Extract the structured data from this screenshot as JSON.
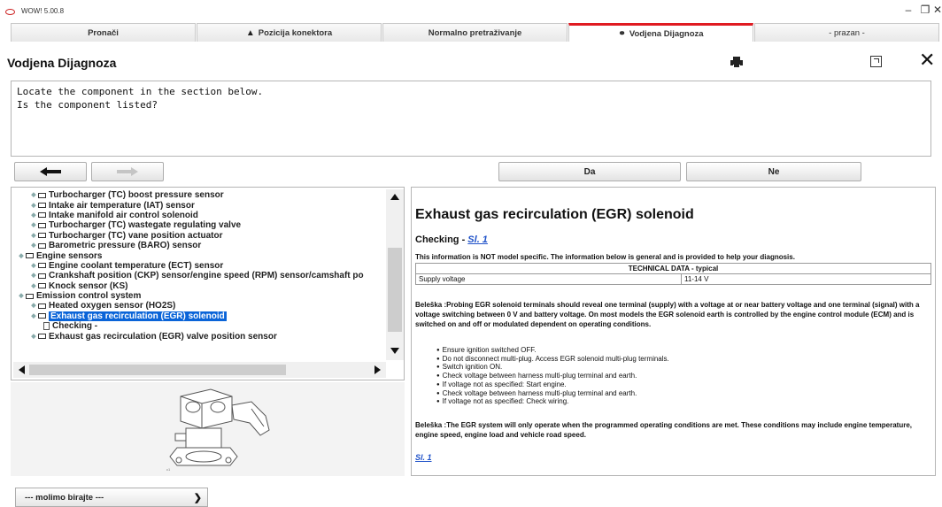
{
  "window": {
    "title": "WOW! 5.00.8",
    "controls": [
      "–",
      "❐",
      "✕"
    ]
  },
  "tabs": [
    {
      "label": "Pronači",
      "icon": "",
      "active": false
    },
    {
      "label": "Pozicija konektora",
      "icon": "connector-icon",
      "active": false
    },
    {
      "label": "Normalno pretraživanje",
      "icon": "",
      "active": false
    },
    {
      "label": "Vodjena Dijagnoza",
      "icon": "stethoscope-icon",
      "active": true
    },
    {
      "label": "- prazan -",
      "icon": "",
      "active": false
    }
  ],
  "header": {
    "title": "Vodjena Dijagnoza",
    "close": "✕"
  },
  "question": {
    "text": "Locate the component in the section below.\nIs the component listed?"
  },
  "nav": {
    "yes": "Da",
    "no": "Ne"
  },
  "tree": {
    "items": [
      {
        "level": 2,
        "label": "Turbocharger (TC) boost pressure sensor",
        "type": "folder",
        "selected": false
      },
      {
        "level": 2,
        "label": "Intake air temperature (IAT) sensor",
        "type": "folder",
        "selected": false
      },
      {
        "level": 2,
        "label": "Intake manifold air control solenoid",
        "type": "folder",
        "selected": false
      },
      {
        "level": 2,
        "label": "Turbocharger (TC) wastegate regulating valve",
        "type": "folder",
        "selected": false
      },
      {
        "level": 2,
        "label": "Turbocharger (TC) vane position actuator",
        "type": "folder",
        "selected": false
      },
      {
        "level": 2,
        "label": "Barometric pressure (BARO) sensor",
        "type": "folder",
        "selected": false
      },
      {
        "level": 1,
        "label": "Engine sensors",
        "type": "folder",
        "selected": false
      },
      {
        "level": 2,
        "label": "Engine coolant temperature (ECT) sensor",
        "type": "folder",
        "selected": false
      },
      {
        "level": 2,
        "label": "Crankshaft position (CKP) sensor/engine speed (RPM) sensor/camshaft po",
        "type": "folder",
        "selected": false
      },
      {
        "level": 2,
        "label": "Knock sensor (KS)",
        "type": "folder",
        "selected": false
      },
      {
        "level": 1,
        "label": "Emission control system",
        "type": "folder",
        "selected": false
      },
      {
        "level": 2,
        "label": "Heated oxygen sensor (HO2S)",
        "type": "folder",
        "selected": false
      },
      {
        "level": 2,
        "label": "Exhaust gas recirculation (EGR) solenoid",
        "type": "folder",
        "selected": true
      },
      {
        "level": 3,
        "label": "Checking -",
        "type": "doc",
        "selected": false
      },
      {
        "level": 2,
        "label": "Exhaust gas recirculation (EGR) valve position sensor",
        "type": "folder",
        "selected": false
      }
    ]
  },
  "info": {
    "title": "Exhaust gas recirculation (EGR) solenoid",
    "checking_label": "Checking - ",
    "checking_link": "Sl. 1",
    "note": "This information is NOT model specific. The information below is general and is provided to help your diagnosis.",
    "tech_header": "TECHNICAL DATA - typical",
    "tech_rows": [
      {
        "name": "Supply voltage",
        "value": "11-14 V"
      }
    ],
    "paragraph1": "Beleška :Probing EGR solenoid terminals should reveal one terminal (supply) with a voltage at or near battery voltage and one terminal (signal) with a voltage switching between 0 V and battery voltage. On most models the EGR solenoid earth is controlled by the engine control module (ECM) and is switched on and off or modulated dependent on operating conditions.",
    "steps": [
      "Ensure ignition switched OFF.",
      "Do not disconnect multi-plug. Access EGR solenoid multi-plug terminals.",
      "Switch ignition ON.",
      "Check voltage between harness multi-plug terminal and earth.",
      "If voltage not as specified: Start engine.",
      "Check voltage between harness multi-plug terminal and earth.",
      "If voltage not as specified: Check wiring."
    ],
    "paragraph2": "Beleška :The EGR system will only operate when the programmed operating conditions are met. These conditions may include engine temperature, engine speed, engine load and vehicle road speed.",
    "figure_link": "Sl. 1"
  },
  "select": {
    "value": "--- molimo birajte ---"
  },
  "colors": {
    "active_tab": "#e01b22",
    "selection": "#0a64d8",
    "link": "#1f52c9"
  }
}
